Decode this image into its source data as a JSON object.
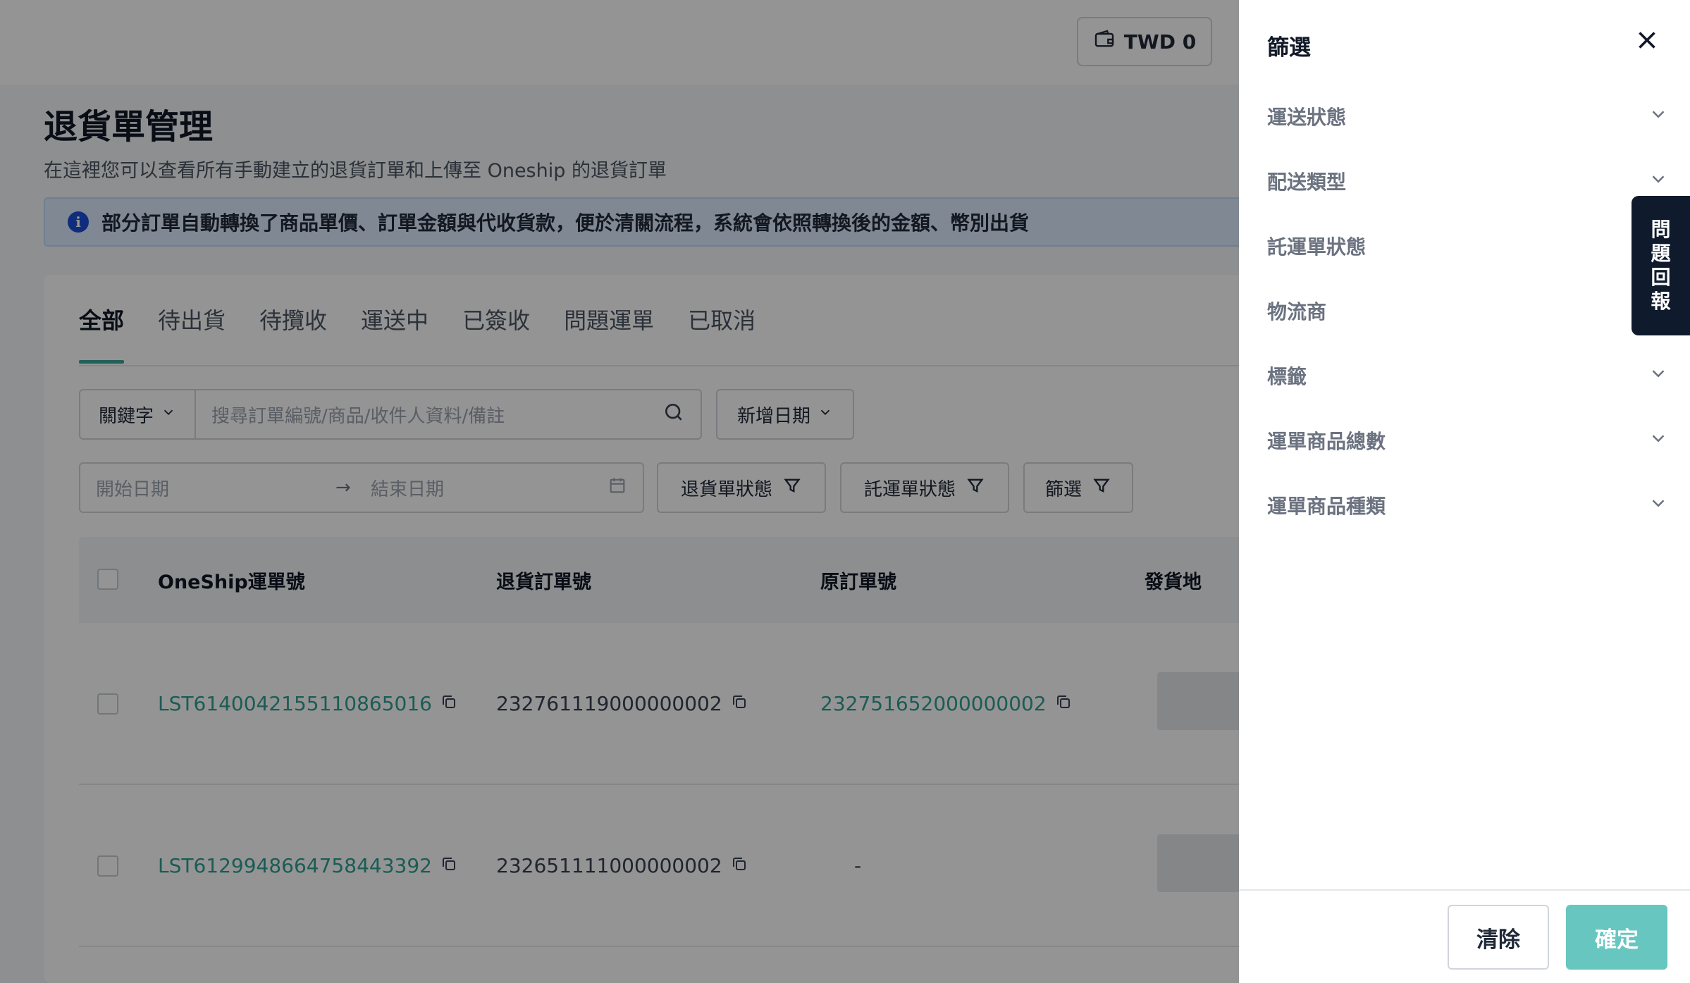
{
  "header": {
    "wallet_label": "TWD 0"
  },
  "page": {
    "title": "退貨單管理",
    "subtitle": "在這裡您可以查看所有手動建立的退貨訂單和上傳至 Oneship 的退貨訂單",
    "notice": "部分訂單自動轉換了商品單價、訂單金額與代收貨款，便於清關流程，系統會依照轉換後的金額、幣別出貨"
  },
  "tabs": [
    {
      "label": "全部"
    },
    {
      "label": "待出貨"
    },
    {
      "label": "待攬收"
    },
    {
      "label": "運送中"
    },
    {
      "label": "已簽收"
    },
    {
      "label": "問題運單"
    },
    {
      "label": "已取消"
    }
  ],
  "search": {
    "keyword_select": "關鍵字",
    "placeholder": "搜尋訂單編號/商品/收件人資料/備註",
    "date_type": "新增日期",
    "start_placeholder": "開始日期",
    "end_placeholder": "結束日期"
  },
  "filters": {
    "return_status": "退貨單狀態",
    "waybill_status": "託運單狀態",
    "filter": "篩選"
  },
  "table": {
    "columns": [
      "OneShip運單號",
      "退貨訂單號",
      "原訂單號",
      "發貨地"
    ],
    "rows": [
      {
        "oneship_no": "LST6140042155110865016",
        "return_no": "232761119000000002",
        "original_no": "232751652000000002"
      },
      {
        "oneship_no": "LST6129948664758443392",
        "return_no": "232651111000000002",
        "original_no": "-"
      }
    ]
  },
  "drawer": {
    "title": "篩選",
    "items": [
      {
        "label": "運送狀態"
      },
      {
        "label": "配送類型"
      },
      {
        "label": "託運單狀態"
      },
      {
        "label": "物流商"
      },
      {
        "label": "標籤"
      },
      {
        "label": "運單商品總數"
      },
      {
        "label": "運單商品種類"
      }
    ],
    "clear_label": "清除",
    "confirm_label": "確定"
  },
  "feedback": {
    "label": "問題回報"
  },
  "colors": {
    "accent": "#3aa89c",
    "confirm": "#67c7c0",
    "link": "#2f9f93",
    "feedback_bg": "#0f1b2d"
  }
}
